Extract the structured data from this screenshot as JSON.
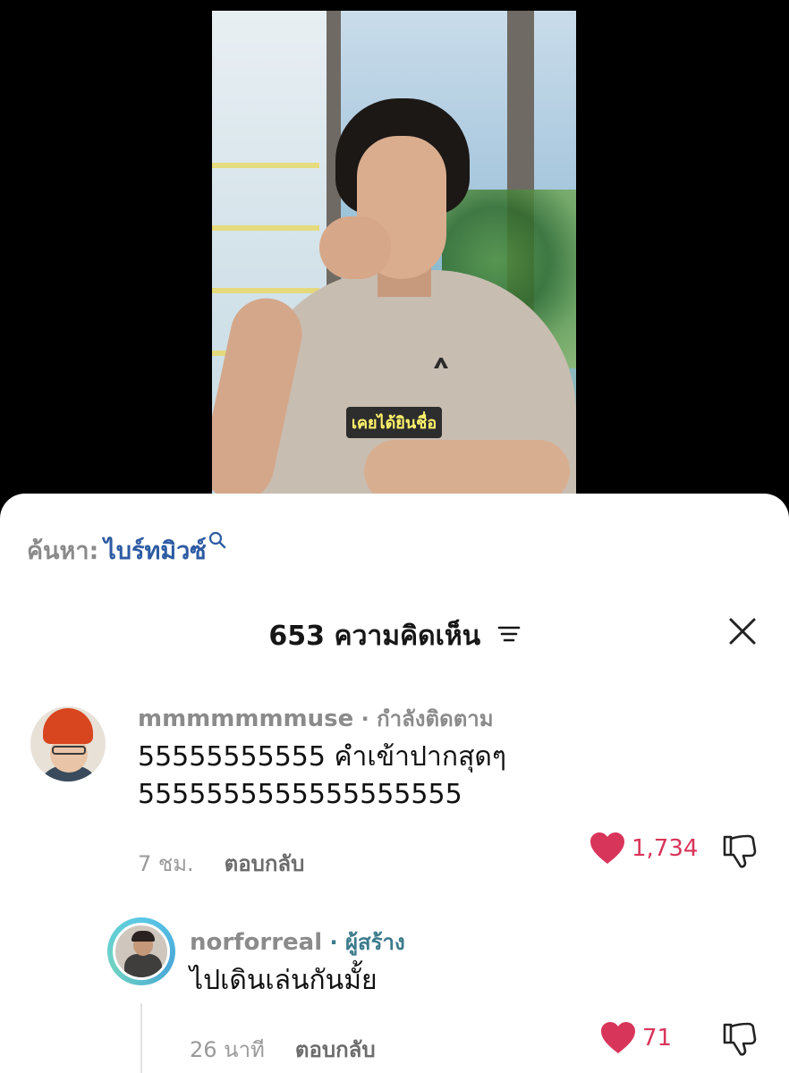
{
  "video": {
    "subtitle": "เคยได้ยินชื่อ"
  },
  "search": {
    "prefix": "ค้นหา:",
    "query": "ไบร์ทมิวซ์"
  },
  "comments_header": {
    "count": "653",
    "label": "ความคิดเห็น"
  },
  "comments": [
    {
      "username": "mmmmmmmuse",
      "tag": " · กำลังติดตาม",
      "text_line1": "55555555555 คำเข้าปากสุดๆ",
      "text_line2": "5555555555555555555",
      "time": "7 ชม.",
      "reply_label": "ตอบกลับ",
      "likes": "1,734"
    },
    {
      "username": "norforreal",
      "tag": " · ผู้สร้าง",
      "text_line1": "ไปเดินเล่นกันมั้ย",
      "time": "26 นาที",
      "reply_label": "ตอบกลับ",
      "likes": "71"
    }
  ],
  "colors": {
    "like": "#d8355a",
    "search_query": "#2d5ba3",
    "creator_tag": "#3c7b8c"
  }
}
